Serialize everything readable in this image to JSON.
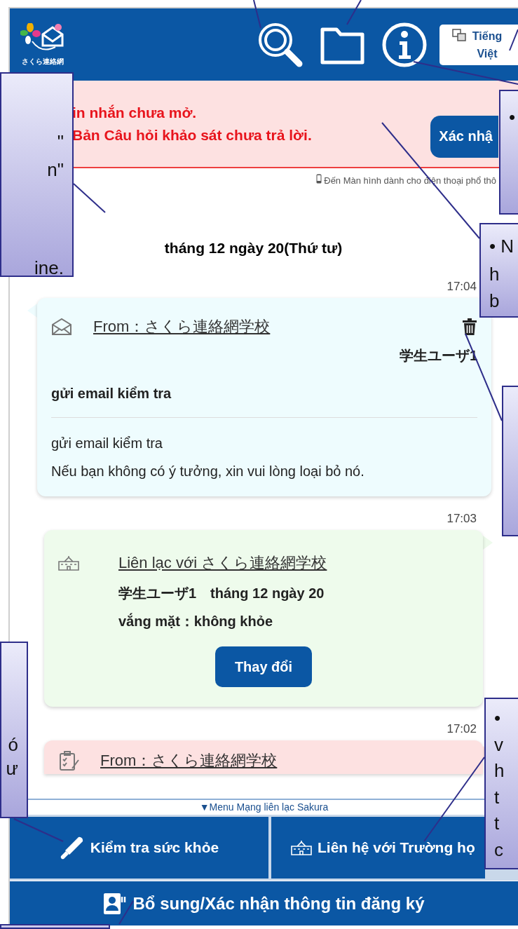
{
  "header": {
    "logo_text": "さくら連絡網",
    "language_button": "Tiếng Việt"
  },
  "alert": {
    "lines": [
      "in nhắn chưa mở.",
      "Bản Câu hỏi khảo sát chưa trả lời."
    ],
    "button": "Xác nhậ"
  },
  "feature_phone_link": "Đến Màn hình dành cho điện thoại phổ thô",
  "date": "tháng 12 ngày 20(Thứ tư)",
  "messages": [
    {
      "kind": "email",
      "time": "17:04",
      "title": "From：さくら連絡網学校",
      "user": "学生ユーザ1",
      "subject": "gửi email kiểm tra",
      "body": [
        "gửi email kiểm tra",
        "Nếu bạn không có ý tưởng, xin vui lòng loại bỏ nó."
      ]
    },
    {
      "kind": "contact",
      "time": "17:03",
      "title": "Liên lạc với さくら連絡網学校",
      "lines": [
        "学生ユーザ1　tháng 12 ngày 20",
        "vắng mặt：không khỏe"
      ],
      "button": "Thay đổi"
    },
    {
      "kind": "survey",
      "time": "17:02",
      "title": "From：さくら連絡網学校"
    }
  ],
  "menu": {
    "toggle": "▼Menu Mạng liên lạc Sakura",
    "buttons": [
      {
        "kind": "health",
        "label": "Kiểm tra sức khỏe"
      },
      {
        "kind": "school",
        "label": "Liên hệ với Trường họ"
      },
      {
        "kind": "register",
        "label": "Bổ sung/Xác nhận thông tin đăng ký"
      }
    ]
  },
  "callouts": [
    {
      "kind": "callout",
      "lines": [
        "\"",
        "n\"",
        "ine."
      ]
    },
    {
      "kind": "callout",
      "lines": [
        "•"
      ]
    },
    {
      "kind": "callout",
      "lines": [
        "• N",
        "h",
        "b"
      ]
    },
    {
      "kind": "callout"
    },
    {
      "kind": "callout",
      "lines": [
        "ó",
        "ư"
      ]
    },
    {
      "kind": "callout",
      "lines": [
        "•",
        "v",
        "h",
        "t",
        "t",
        "c"
      ]
    },
    {
      "kind": "callout"
    }
  ]
}
